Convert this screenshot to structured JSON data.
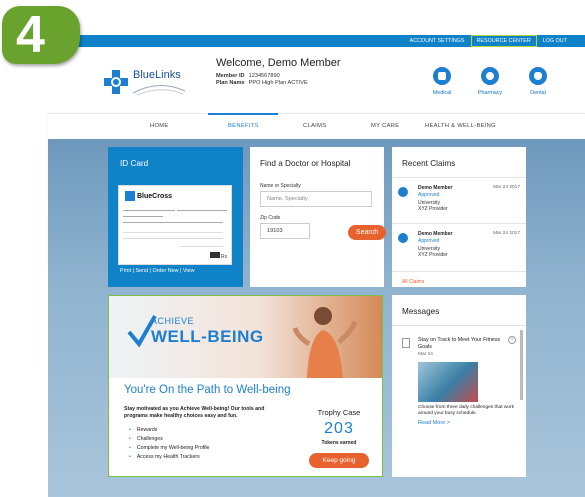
{
  "step_number": "4",
  "topbar": {
    "links": [
      "ACCOUNT SETTINGS",
      "RESOURCE CENTER",
      "LOG OUT"
    ],
    "active": "RESOURCE CENTER"
  },
  "logo": {
    "text": "BlueLinks"
  },
  "welcome": {
    "title": "Welcome, Demo Member",
    "member_id_label": "Member ID",
    "member_id": "1234567890",
    "plan_name_label": "Plan Name",
    "plan_name": "PPO High Plan ACTIVE"
  },
  "quick_links": [
    {
      "label": "Medical",
      "icon": "heart-shield-icon"
    },
    {
      "label": "Pharmacy",
      "icon": "pill-icon"
    },
    {
      "label": "Dental",
      "icon": "tooth-icon"
    }
  ],
  "nav": [
    "HOME",
    "BENEFITS",
    "CLAIMS",
    "MY CARE",
    "HEALTH & WELL-BEING"
  ],
  "nav_active": "BENEFITS",
  "id_card": {
    "title": "ID Card",
    "brand": "BlueCross",
    "links": "Print  |  Send  |  Order New  |  View"
  },
  "find_doctor": {
    "title": "Find a Doctor or Hospital",
    "name_label": "Name or Specialty",
    "name_placeholder": "Name, Specialty",
    "zip_label": "Zip Code",
    "zip_value": "19103",
    "search_label": "Search"
  },
  "recent_claims": {
    "title": "Recent Claims",
    "items": [
      {
        "name": "Demo Member",
        "status": "Approved",
        "date": "Mar 24 2017",
        "provider_line1": "University",
        "provider_line2": "XYZ Provider"
      },
      {
        "name": "Demo Member",
        "status": "Approved",
        "date": "Mar 24 2017",
        "provider_line1": "University",
        "provider_line2": "XYZ Provider"
      }
    ],
    "all_link": "All Claims"
  },
  "wellbeing": {
    "achieve": "ACHIEVE",
    "wellbeing": "WELL-BEING",
    "heading": "You're On the Path to Well-being",
    "intro": "Stay motivated as you Achieve Well-being! Our tools and programs make healthy choices easy and fun.",
    "bullets": [
      "Rewards",
      "Challenges",
      "Complete my Well-being Profile",
      "Access my Health Trackers"
    ],
    "trophy_title": "Trophy Case",
    "tokens": "203",
    "tokens_label": "Tokens earned",
    "button": "Keep going"
  },
  "messages": {
    "title": "Messages",
    "item_title": "Stay on Track to Meet Your Fitness Goals",
    "item_date": "Mar 24",
    "item_body": "Choose from three daily challenges that work around your busy schedule.",
    "read_more": "Read More  >"
  },
  "colors": {
    "primary": "#1d7fd0",
    "accent": "#e8622d",
    "green": "#6aa22e"
  }
}
